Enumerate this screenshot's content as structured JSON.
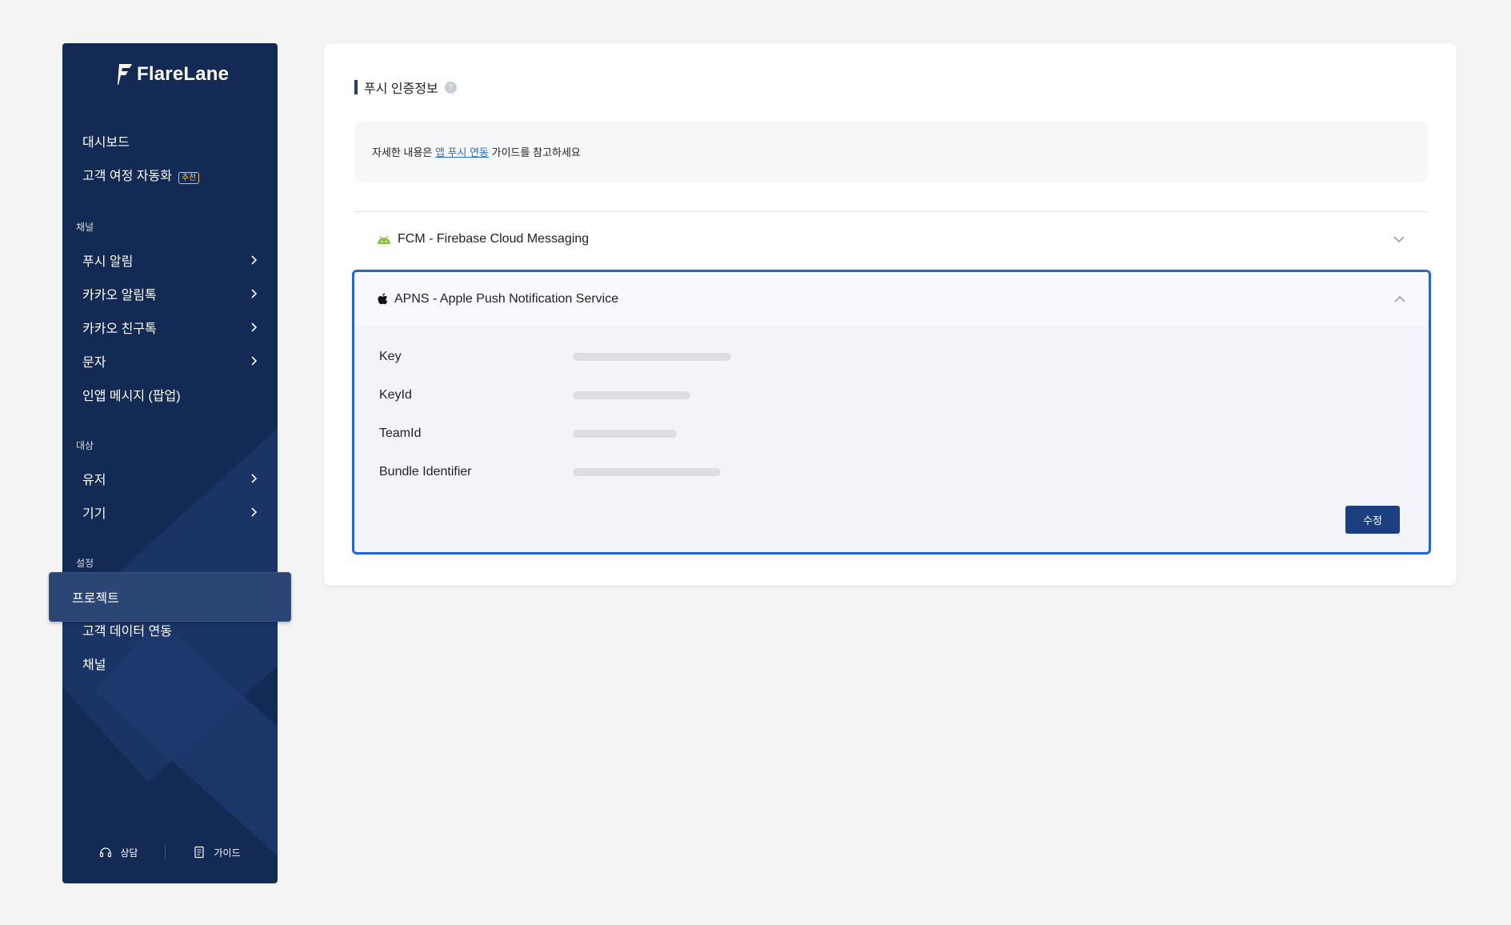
{
  "brand": {
    "name": "FlareLane"
  },
  "sidebar": {
    "top_items": [
      {
        "label": "대시보드"
      },
      {
        "label": "고객 여정 자동화",
        "badge": "추천"
      }
    ],
    "sections": {
      "channel": "채널",
      "target": "대상",
      "settings": "설정"
    },
    "channel_items": [
      {
        "label": "푸시 알림"
      },
      {
        "label": "카카오 알림톡"
      },
      {
        "label": "카카오 친구톡"
      },
      {
        "label": "문자"
      },
      {
        "label": "인앱 메시지 (팝업)"
      }
    ],
    "target_items": [
      {
        "label": "유저"
      },
      {
        "label": "기기"
      }
    ],
    "settings_items": [
      {
        "label": "프로젝트",
        "active": true
      },
      {
        "label": "고객 데이터 연동"
      },
      {
        "label": "채널"
      }
    ],
    "footer": {
      "consult": "상담",
      "guide": "가이드"
    }
  },
  "main": {
    "title": "푸시 인증정보",
    "info": {
      "prefix": "자세한 내용은 ",
      "link": "앱 푸시 연동",
      "suffix": " 가이드를 참고하세요"
    },
    "providers": [
      {
        "name": "FCM - Firebase Cloud Messaging",
        "expanded": false
      },
      {
        "name": "APNS - Apple Push Notification Service",
        "expanded": true
      }
    ],
    "apns_fields": [
      {
        "label": "Key"
      },
      {
        "label": "KeyId"
      },
      {
        "label": "TeamId"
      },
      {
        "label": "Bundle Identifier"
      }
    ],
    "edit_label": "수정"
  },
  "colors": {
    "sidebar": "#132a54",
    "accent": "#1c3f7f",
    "highlight": "#2366d1",
    "badge": "#f5c243",
    "android": "#8bc34a"
  }
}
